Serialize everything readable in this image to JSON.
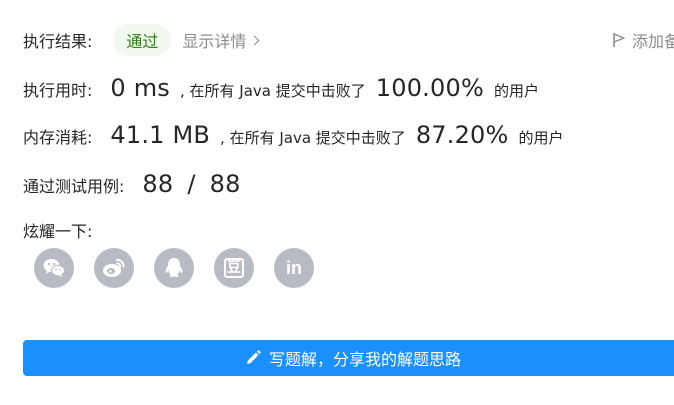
{
  "result": {
    "label": "执行结果:",
    "status": "通过",
    "details_link": "显示详情",
    "add_note": "添加备"
  },
  "runtime": {
    "label": "执行用时:",
    "value": "0 ms",
    "middle": ", 在所有 Java 提交中击败了",
    "percent": "100.00%",
    "suffix": "的用户"
  },
  "memory": {
    "label": "内存消耗:",
    "value": "41.1 MB",
    "middle": ", 在所有 Java 提交中击败了",
    "percent": "87.20%",
    "suffix": "的用户"
  },
  "tests": {
    "label": "通过测试用例:",
    "passed": "88",
    "separator": "/",
    "total": "88"
  },
  "share": {
    "label": "炫耀一下:",
    "buttons": [
      {
        "icon": "wechat-icon"
      },
      {
        "icon": "weibo-icon"
      },
      {
        "icon": "qq-icon"
      },
      {
        "icon": "douban-icon",
        "glyph": "豆"
      },
      {
        "icon": "linkedin-icon",
        "glyph": "in"
      }
    ]
  },
  "solution_button": {
    "label": "写题解，分享我的解题思路"
  },
  "colors": {
    "accent": "#1a90ff",
    "pass_bg": "#f1f8ee",
    "pass_text": "#2f7d17",
    "share_btn": "#b8bcc2"
  }
}
